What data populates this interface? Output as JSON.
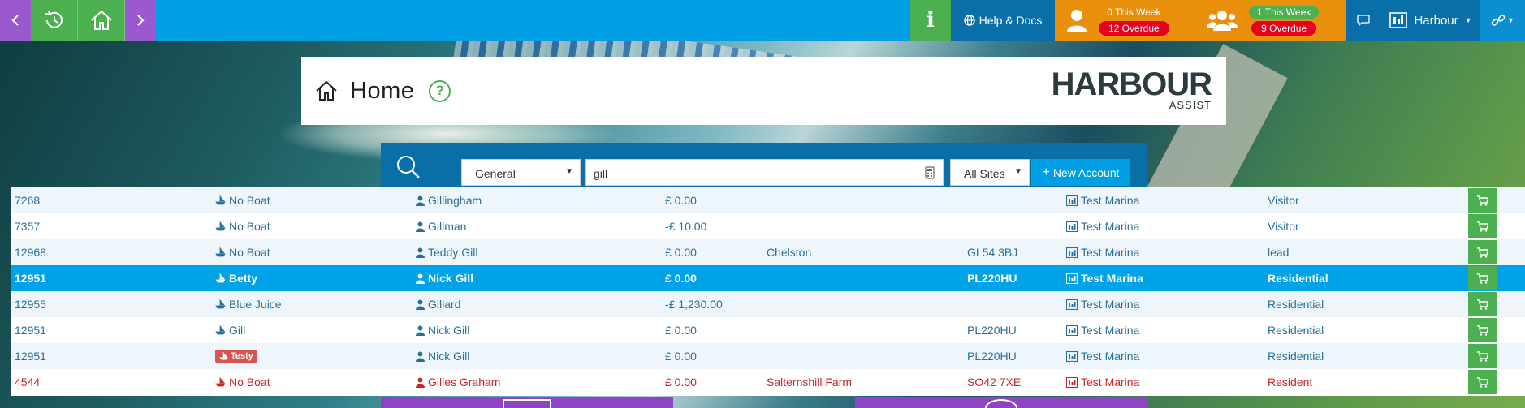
{
  "nav": {
    "back_icon": "chevron-left-icon",
    "history_icon": "history-icon",
    "home_icon": "home-icon",
    "forward_icon": "chevron-right-icon",
    "info_label": "i",
    "help_label": "Help & Docs",
    "tasks": {
      "this_week": "0 This Week",
      "overdue": "12 Overdue"
    },
    "team_tasks": {
      "this_week": "1 This Week",
      "overdue": "9 Overdue"
    },
    "harbour_label": "Harbour"
  },
  "header": {
    "title": "Home",
    "help": "?",
    "logo_text": "HARBOUR",
    "logo_sub": "ASSIST"
  },
  "search": {
    "category": "General",
    "query": "gill",
    "sites": "All Sites",
    "new_account": "New Account"
  },
  "results": [
    {
      "id": "7268",
      "boat": "No Boat",
      "name": "Gillingham",
      "balance": "£ 0.00",
      "town": "",
      "postcode": "",
      "site": "Test Marina",
      "type": "Visitor"
    },
    {
      "id": "7357",
      "boat": "No Boat",
      "name": "Gillman",
      "balance": "-£ 10.00",
      "town": "",
      "postcode": "",
      "site": "Test Marina",
      "type": "Visitor"
    },
    {
      "id": "12968",
      "boat": "No Boat",
      "name": "Teddy Gill",
      "balance": "£ 0.00",
      "town": "Chelston",
      "postcode": "GL54 3BJ",
      "site": "Test Marina",
      "type": "lead"
    },
    {
      "id": "12951",
      "boat": "Betty",
      "name": "Nick Gill",
      "balance": "£ 0.00",
      "town": "",
      "postcode": "PL220HU",
      "site": "Test Marina",
      "type": "Residential"
    },
    {
      "id": "12955",
      "boat": "Blue Juice",
      "name": "Gillard",
      "balance": "-£ 1,230.00",
      "town": "",
      "postcode": "",
      "site": "Test Marina",
      "type": "Residential"
    },
    {
      "id": "12951",
      "boat": "Gill",
      "name": "Nick Gill",
      "balance": "£ 0.00",
      "town": "",
      "postcode": "PL220HU",
      "site": "Test Marina",
      "type": "Residential"
    },
    {
      "id": "12951",
      "boat": "Testy",
      "name": "Nick Gill",
      "balance": "£ 0.00",
      "town": "",
      "postcode": "PL220HU",
      "site": "Test Marina",
      "type": "Residential"
    },
    {
      "id": "4544",
      "boat": "No Boat",
      "name": "Gilles Graham",
      "balance": "£ 0.00",
      "town": "Salternshill Farm",
      "postcode": "SO42 7XE",
      "site": "Test Marina",
      "type": "Resident"
    }
  ],
  "colors": {
    "nav_blue": "#009fe3",
    "nav_green": "#4cb050",
    "nav_purple": "#9b59d0",
    "nav_orange": "#e8900c",
    "selected_row": "#00a2e8",
    "overdue_red": "#c62828"
  }
}
